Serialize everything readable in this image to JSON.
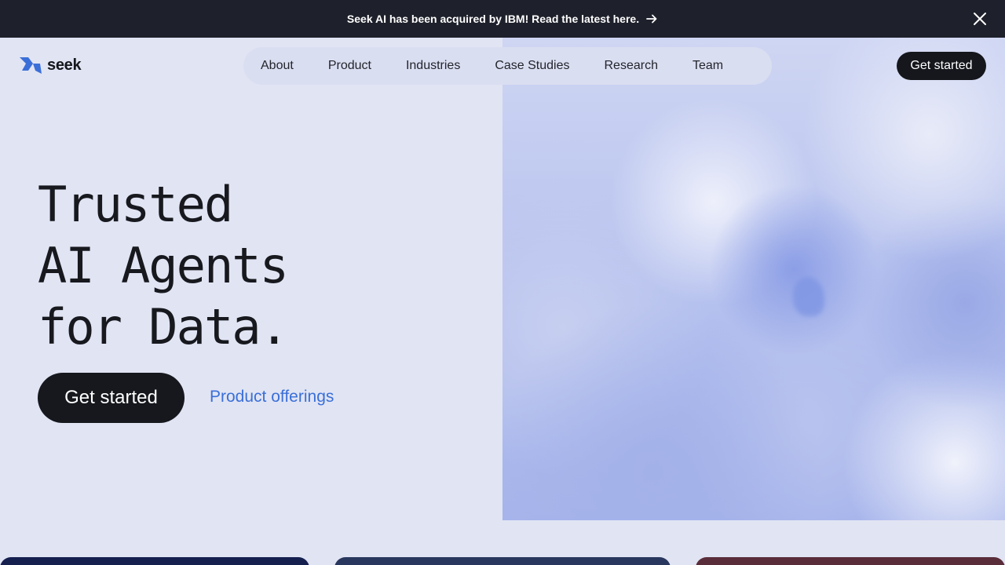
{
  "announcement": {
    "text": "Seek AI has been acquired by IBM! Read the latest here.",
    "arrow_icon": "arrow-right-icon",
    "close_icon": "close-icon"
  },
  "brand": {
    "name": "seek",
    "logo_icon": "seek-logo-icon",
    "accent_color": "#3a6fd8"
  },
  "nav": {
    "items": [
      {
        "label": "About"
      },
      {
        "label": "Product"
      },
      {
        "label": "Industries"
      },
      {
        "label": "Case Studies"
      },
      {
        "label": "Research"
      },
      {
        "label": "Team"
      }
    ]
  },
  "header": {
    "cta_label": "Get started"
  },
  "hero": {
    "title_lines": [
      "Trusted",
      "AI Agents",
      "for Data."
    ],
    "primary_cta": "Get started",
    "secondary_link": "Product offerings"
  },
  "cards": {
    "colors": [
      "#16204f",
      "#29375e",
      "#5a2d3a"
    ]
  }
}
